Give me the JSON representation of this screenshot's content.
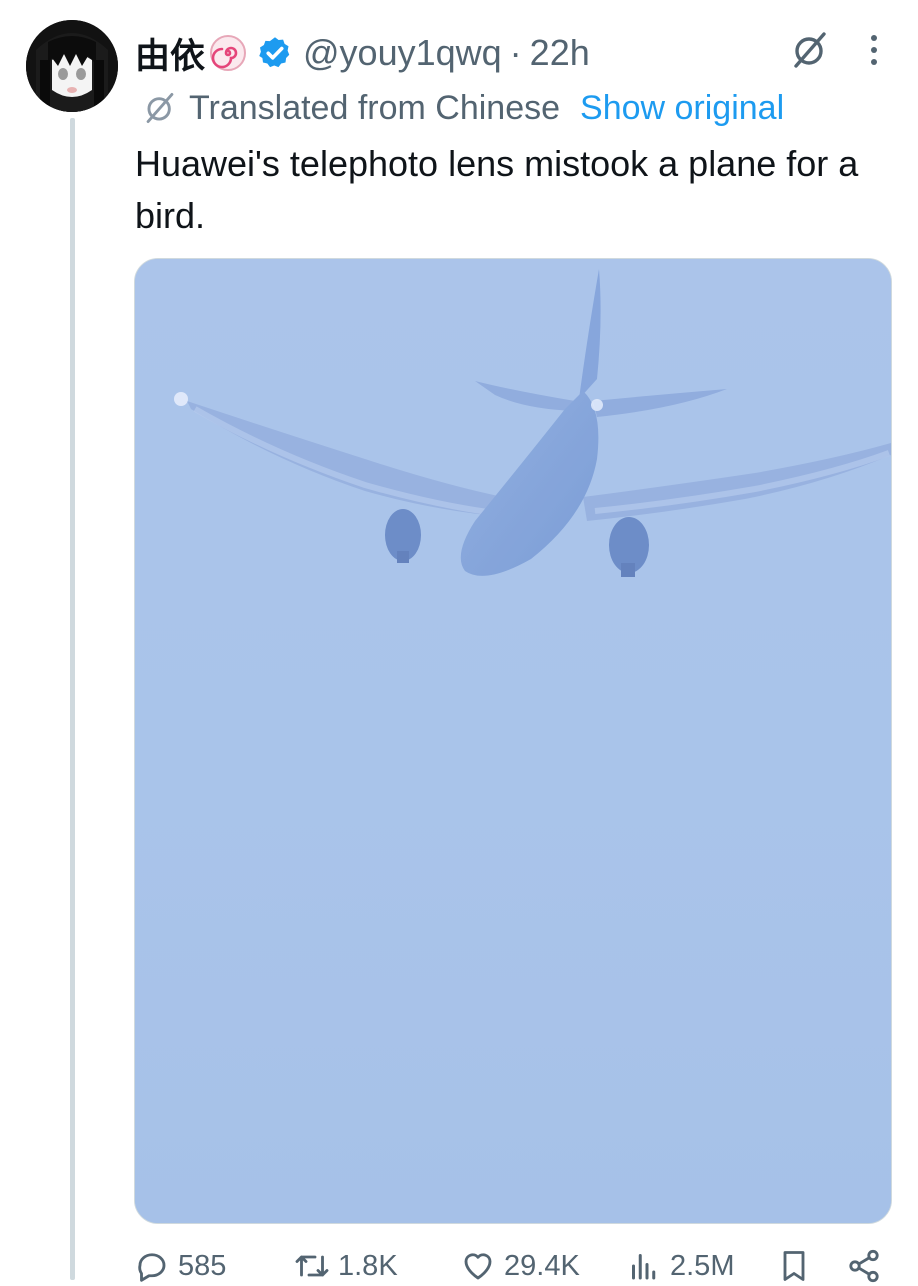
{
  "tweet": {
    "display_name": "由依",
    "emoji_badge": "naruto-fishcake-emoji",
    "verified": true,
    "handle": "@youy1qwq",
    "separator": "·",
    "timestamp": "22h",
    "translated_label": "Translated from Chinese",
    "show_original_label": "Show original",
    "text": "Huawei's telephoto lens mistook a plane for a bird."
  },
  "actions": {
    "replies": "585",
    "retweets": "1.8K",
    "likes": "29.4K",
    "views": "2.5M"
  },
  "icons": {
    "header": [
      "grok-icon",
      "more-options-icon"
    ],
    "translate": "translate-icon",
    "action_bar": [
      "reply-icon",
      "retweet-icon",
      "like-icon",
      "views-icon",
      "bookmark-icon",
      "share-icon"
    ]
  },
  "colors": {
    "link": "#1d9bf0",
    "verified": "#1d9bf0",
    "secondary_text": "#536471",
    "primary_text": "#0f1419",
    "sky": "#a5c0e6"
  }
}
